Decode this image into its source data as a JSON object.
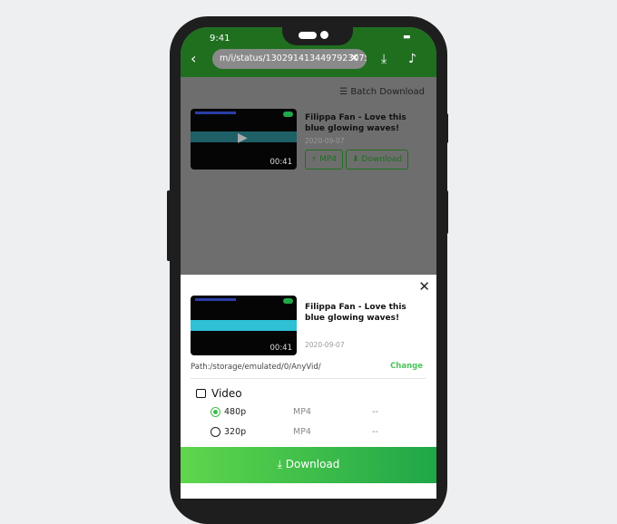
{
  "status": {
    "time": "9:41"
  },
  "header": {
    "url": "m/i/status/1302914134497923075",
    "back_icon": "chevron-left-icon",
    "clear_icon": "close-icon",
    "download_icon": "download-box-icon",
    "tiktok_icon": "music-note-icon"
  },
  "main": {
    "batch_label": "Batch Download",
    "video": {
      "title": "Filippa Fan - Love this blue glowing waves!",
      "date": "2020-09-07",
      "duration": "00:41",
      "format_button": "MP4",
      "download_button": "Download"
    }
  },
  "sheet": {
    "title": "Filippa Fan - Love this blue glowing waves!",
    "date": "2020-09-07",
    "duration": "00:41",
    "path": "Path:/storage/emulated/0/AnyVid/",
    "change": "Change",
    "section": "Video",
    "options": [
      {
        "quality": "480p",
        "format": "MP4",
        "size": "--",
        "selected": true
      },
      {
        "quality": "320p",
        "format": "MP4",
        "size": "--",
        "selected": false
      }
    ],
    "download": "Download"
  },
  "colors": {
    "accent": "#3fbe4c",
    "header": "#2b9a2f"
  }
}
